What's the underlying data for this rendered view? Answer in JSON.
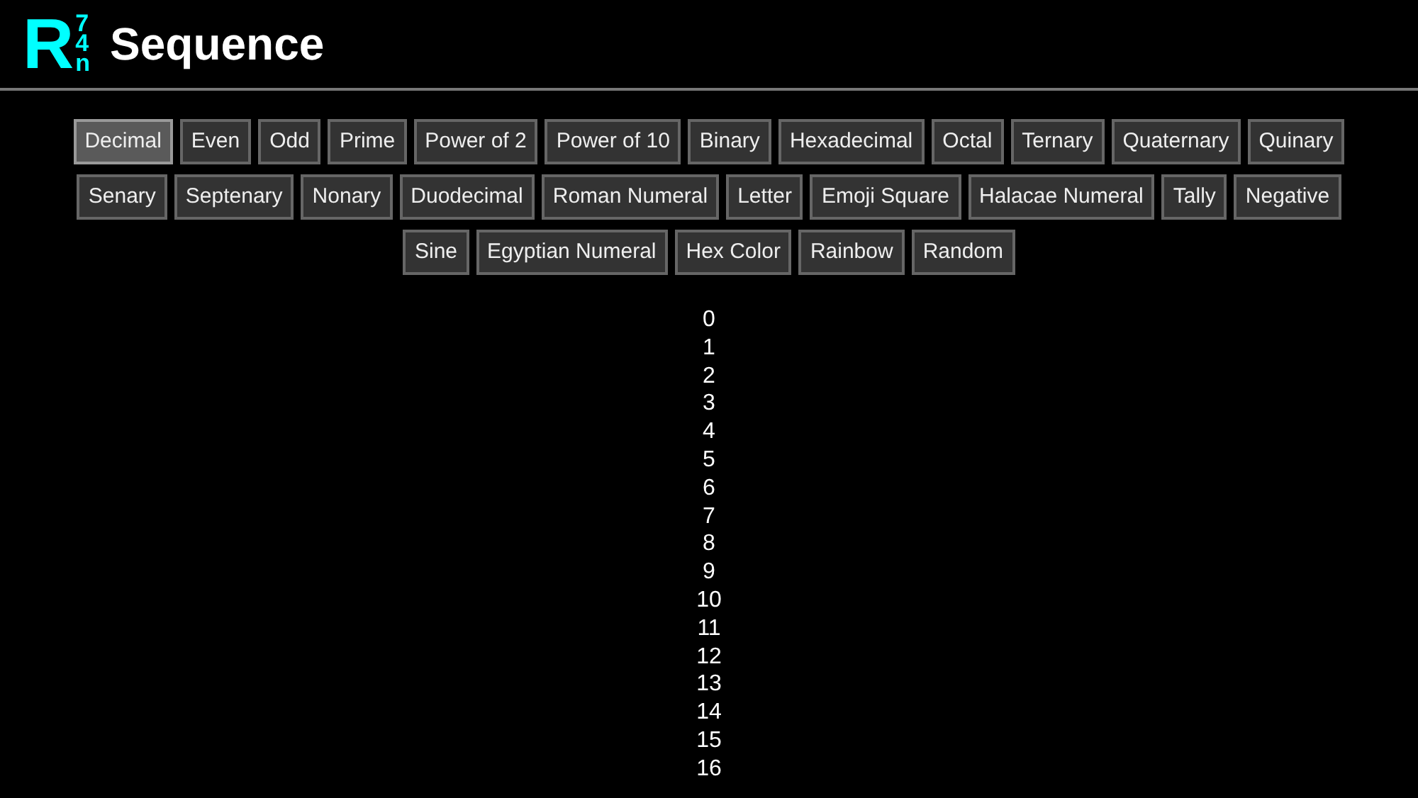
{
  "logo": {
    "letter": "R",
    "stack": [
      "7",
      "4",
      "n"
    ]
  },
  "title": "Sequence",
  "sequences": [
    {
      "label": "Decimal",
      "selected": true
    },
    {
      "label": "Even",
      "selected": false
    },
    {
      "label": "Odd",
      "selected": false
    },
    {
      "label": "Prime",
      "selected": false
    },
    {
      "label": "Power of 2",
      "selected": false
    },
    {
      "label": "Power of 10",
      "selected": false
    },
    {
      "label": "Binary",
      "selected": false
    },
    {
      "label": "Hexadecimal",
      "selected": false
    },
    {
      "label": "Octal",
      "selected": false
    },
    {
      "label": "Ternary",
      "selected": false
    },
    {
      "label": "Quaternary",
      "selected": false
    },
    {
      "label": "Quinary",
      "selected": false
    },
    {
      "label": "Senary",
      "selected": false
    },
    {
      "label": "Septenary",
      "selected": false
    },
    {
      "label": "Nonary",
      "selected": false
    },
    {
      "label": "Duodecimal",
      "selected": false
    },
    {
      "label": "Roman Numeral",
      "selected": false
    },
    {
      "label": "Letter",
      "selected": false
    },
    {
      "label": "Emoji Square",
      "selected": false
    },
    {
      "label": "Halacae Numeral",
      "selected": false
    },
    {
      "label": "Tally",
      "selected": false
    },
    {
      "label": "Negative",
      "selected": false
    },
    {
      "label": "Sine",
      "selected": false
    },
    {
      "label": "Egyptian Numeral",
      "selected": false
    },
    {
      "label": "Hex Color",
      "selected": false
    },
    {
      "label": "Rainbow",
      "selected": false
    },
    {
      "label": "Random",
      "selected": false
    }
  ],
  "values": [
    "0",
    "1",
    "2",
    "3",
    "4",
    "5",
    "6",
    "7",
    "8",
    "9",
    "10",
    "11",
    "12",
    "13",
    "14",
    "15",
    "16"
  ]
}
